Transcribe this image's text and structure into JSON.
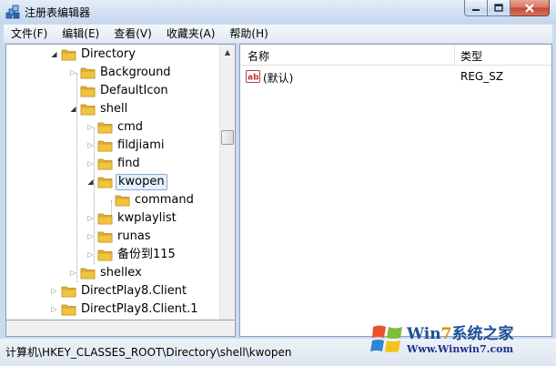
{
  "window": {
    "title": "注册表编辑器",
    "buttons": {
      "minimize": "–",
      "maximize": "□",
      "close": "✕"
    }
  },
  "menu": [
    {
      "label": "文件(F)"
    },
    {
      "label": "编辑(E)"
    },
    {
      "label": "查看(V)"
    },
    {
      "label": "收藏夹(A)"
    },
    {
      "label": "帮助(H)"
    }
  ],
  "tree": [
    {
      "label": "Directory",
      "expander": "open",
      "selected": false
    },
    {
      "label": "Background",
      "expander": "closed",
      "selected": false
    },
    {
      "label": "DefaultIcon",
      "expander": "none",
      "selected": false
    },
    {
      "label": "shell",
      "expander": "open",
      "selected": false
    },
    {
      "label": "cmd",
      "expander": "closed",
      "selected": false
    },
    {
      "label": "fildjiami",
      "expander": "closed",
      "selected": false
    },
    {
      "label": "find",
      "expander": "closed",
      "selected": false
    },
    {
      "label": "kwopen",
      "expander": "open",
      "selected": true
    },
    {
      "label": "command",
      "expander": "none",
      "selected": false
    },
    {
      "label": "kwplaylist",
      "expander": "closed",
      "selected": false
    },
    {
      "label": "runas",
      "expander": "closed",
      "selected": false
    },
    {
      "label": "备份到115",
      "expander": "closed",
      "selected": false
    },
    {
      "label": "shellex",
      "expander": "closed",
      "selected": false
    },
    {
      "label": "DirectPlay8.Client",
      "expander": "closed",
      "selected": false
    },
    {
      "label": "DirectPlay8.Client.1",
      "expander": "closed",
      "selected": false
    }
  ],
  "values_pane": {
    "columns": {
      "name": "名称",
      "type": "类型"
    },
    "rows": [
      {
        "name": "(默认)",
        "type": "REG_SZ",
        "icon": "ab-string-icon"
      }
    ]
  },
  "status": {
    "path": "计算机\\HKEY_CLASSES_ROOT\\Directory\\shell\\kwopen"
  },
  "watermark": {
    "title_prefix": "Win",
    "title_seven": "7",
    "title_suffix": "系统之家",
    "url": "Www.Winwin7.com"
  },
  "colors": {
    "selection_border": "#84acdd",
    "selection_fill": "#e5f0fb",
    "folder": "#f0c53d"
  }
}
